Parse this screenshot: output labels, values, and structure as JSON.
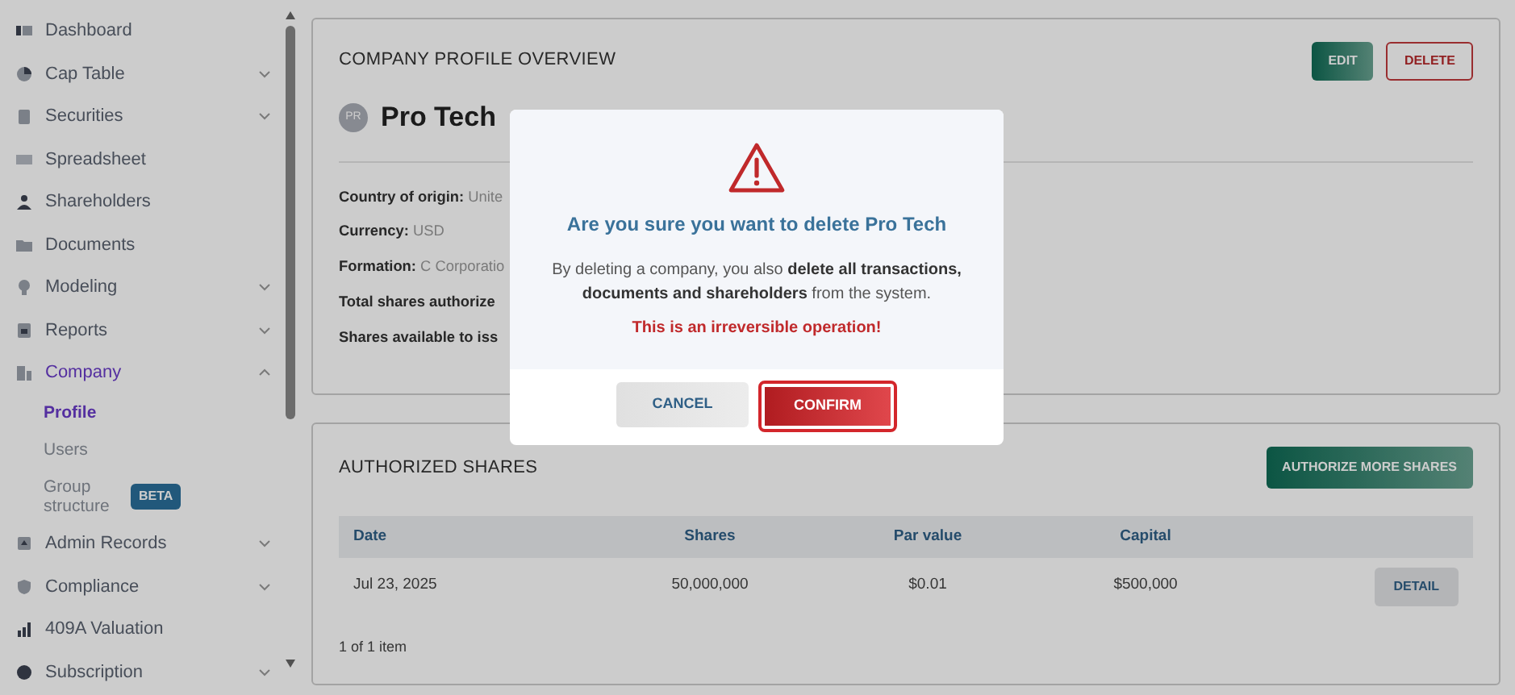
{
  "sidebar": {
    "items": [
      {
        "label": "Dashboard",
        "kind": "link",
        "selected": false
      },
      {
        "label": "Cap Table",
        "kind": "group",
        "selected": false,
        "expanded": false
      },
      {
        "label": "Securities",
        "kind": "group",
        "selected": false,
        "expanded": false
      },
      {
        "label": "Spreadsheet",
        "kind": "link",
        "selected": false
      },
      {
        "label": "Shareholders",
        "kind": "link",
        "selected": false
      },
      {
        "label": "Documents",
        "kind": "link",
        "selected": false
      },
      {
        "label": "Modeling",
        "kind": "group",
        "selected": false,
        "expanded": false
      },
      {
        "label": "Reports",
        "kind": "group",
        "selected": false,
        "expanded": false
      },
      {
        "label": "Company",
        "kind": "group",
        "selected": true,
        "expanded": true,
        "children": [
          {
            "label": "Profile",
            "selected": true
          },
          {
            "label": "Users",
            "selected": false
          },
          {
            "label": "Group structure",
            "selected": false,
            "badge": "BETA"
          }
        ]
      },
      {
        "label": "Admin Records",
        "kind": "group",
        "selected": false,
        "expanded": false
      },
      {
        "label": "Compliance",
        "kind": "group",
        "selected": false,
        "expanded": false
      },
      {
        "label": "409A Valuation",
        "kind": "link",
        "selected": false
      },
      {
        "label": "Subscription",
        "kind": "group",
        "selected": false,
        "expanded": false
      }
    ]
  },
  "profile": {
    "title": "COMPANY PROFILE OVERVIEW",
    "buttons": [
      "EDIT",
      "DELETE"
    ],
    "avatar": "PR",
    "company_name": "Pro Tech",
    "fields": [
      {
        "label": "Country of origin:",
        "value": "Unite"
      },
      {
        "label": "Currency:",
        "value": "USD"
      },
      {
        "label": "Formation:",
        "value": "C Corporatio"
      },
      {
        "label": "Total shares authorize"
      },
      {
        "label": "Shares available to iss"
      }
    ]
  },
  "authorized_shares": {
    "title": "AUTHORIZED SHARES",
    "button": "AUTHORIZE MORE SHARES",
    "table": {
      "columns": [
        "Date",
        "Shares",
        "Par value",
        "Capital"
      ],
      "rows": [
        {
          "cells": [
            "Jul 23, 2025",
            "50,000,000",
            "$0.01",
            "$500,000"
          ],
          "action": "DETAIL"
        }
      ]
    },
    "footer": "1 of 1 item"
  },
  "dialog": {
    "title": "Are you sure you want to delete Pro Tech",
    "message": "By deleting a company, you also **delete all transactions, documents and shareholders** from the system.",
    "warning": "This is an irreversible operation!",
    "buttons": [
      "CANCEL",
      "CONFIRM"
    ]
  }
}
